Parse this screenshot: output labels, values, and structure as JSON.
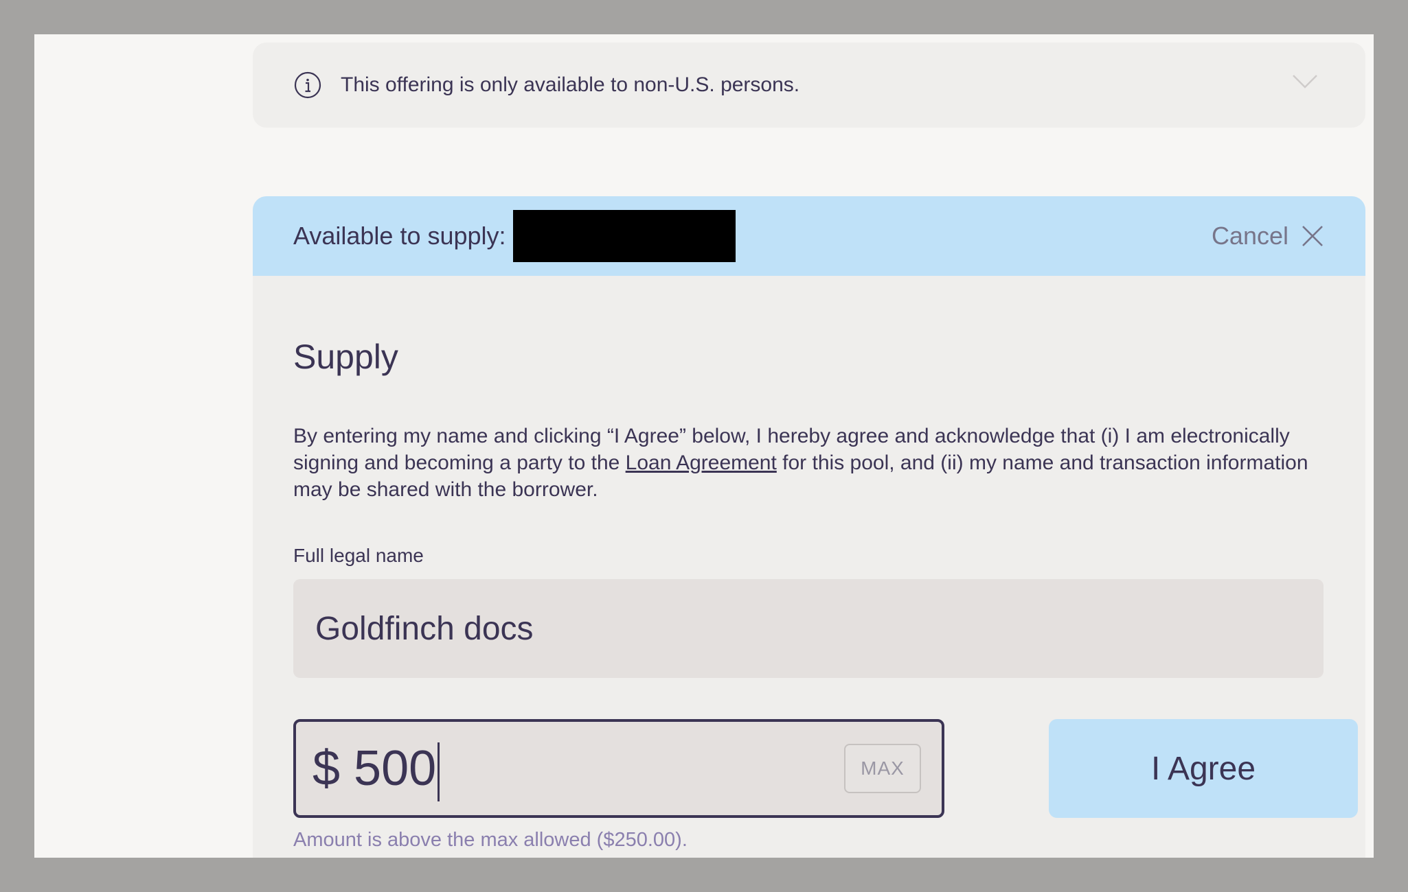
{
  "notice": {
    "icon": "info-icon",
    "text": "This offering is only available to non-U.S. persons.",
    "toggle_icon": "chevron-down-icon"
  },
  "supply_panel": {
    "available_label": "Available to supply:",
    "cancel_label": "Cancel",
    "close_icon": "close-icon",
    "title": "Supply",
    "agreement_before": "By entering my name and clicking “I Agree” below, I hereby agree and acknowledge that (i) I am electronically signing and becoming a party to the ",
    "agreement_link": "Loan Agreement",
    "agreement_after": " for this pool, and (ii) my name and transaction information may be shared with the borrower.",
    "name_label": "Full legal name",
    "name_value": "Goldfinch docs",
    "amount_value": "$ 500",
    "max_label": "MAX",
    "agree_label": "I Agree",
    "error_message": "Amount is above the max allowed ($250.00)."
  },
  "colors": {
    "backdrop": "#a4a3a1",
    "page": "#f7f6f4",
    "card": "#efeeec",
    "accent_blue": "#bfe1f8",
    "text": "#3b3454",
    "input_bg": "#e4e0de",
    "error": "#8a7fae"
  }
}
